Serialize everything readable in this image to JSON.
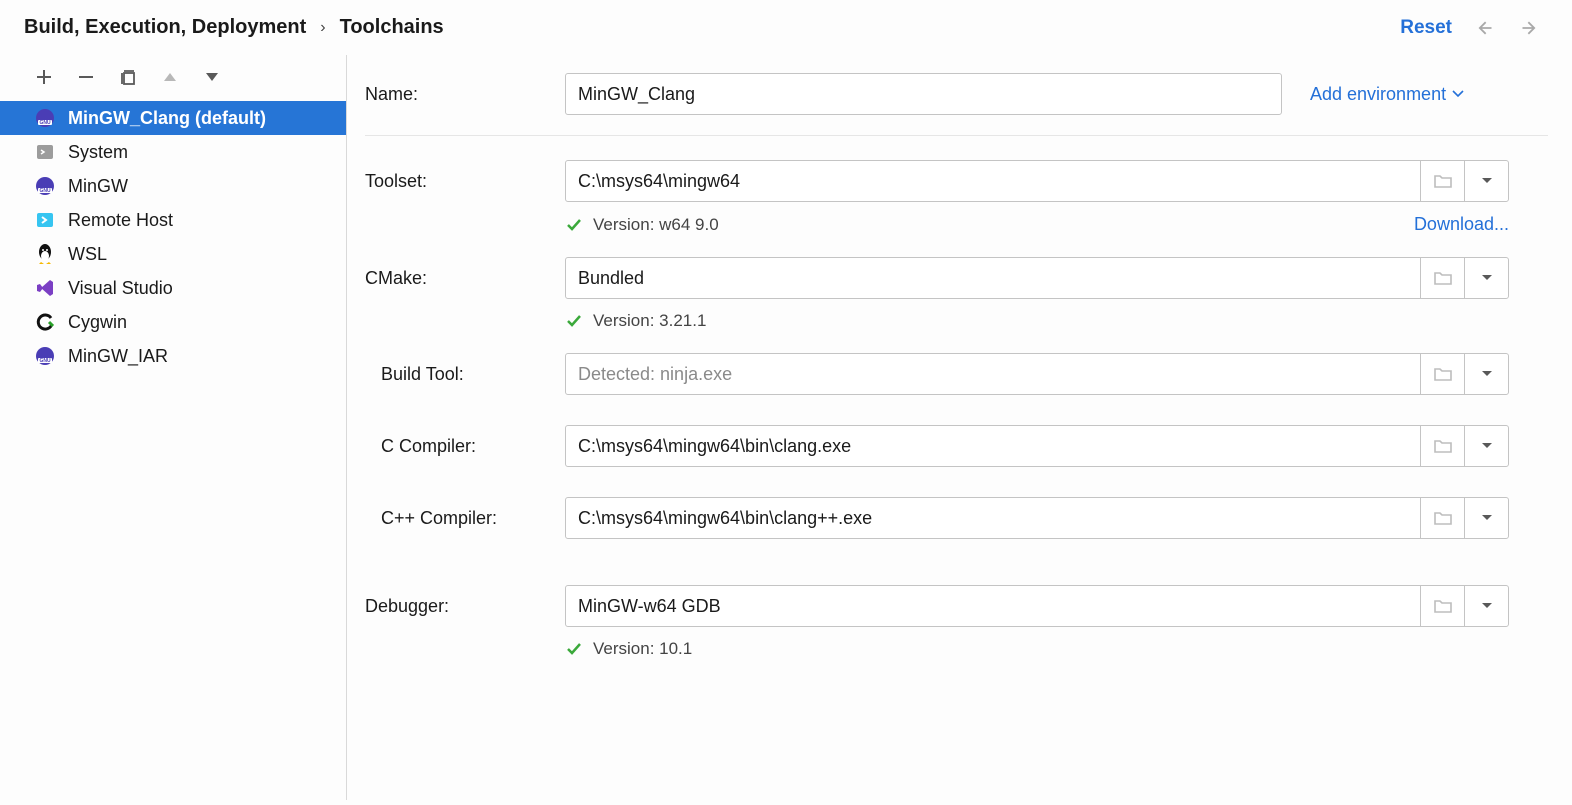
{
  "breadcrumb": {
    "parent": "Build, Execution, Deployment",
    "current": "Toolchains"
  },
  "actions": {
    "reset": "Reset"
  },
  "sidebar": {
    "items": [
      {
        "label": "MinGW_Clang (default)",
        "icon": "gnu",
        "selected": true
      },
      {
        "label": "System",
        "icon": "system",
        "selected": false
      },
      {
        "label": "MinGW",
        "icon": "gnu",
        "selected": false
      },
      {
        "label": "Remote Host",
        "icon": "remote",
        "selected": false
      },
      {
        "label": "WSL",
        "icon": "tux",
        "selected": false
      },
      {
        "label": "Visual Studio",
        "icon": "vs",
        "selected": false
      },
      {
        "label": "Cygwin",
        "icon": "cygwin",
        "selected": false
      },
      {
        "label": "MinGW_IAR",
        "icon": "gnu",
        "selected": false
      }
    ]
  },
  "form": {
    "name_label": "Name:",
    "name_value": "MinGW_Clang",
    "add_env": "Add environment",
    "toolset_label": "Toolset:",
    "toolset_value": "C:\\msys64\\mingw64",
    "toolset_version": "Version: w64 9.0",
    "download": "Download...",
    "cmake_label": "CMake:",
    "cmake_value": "Bundled",
    "cmake_version": "Version: 3.21.1",
    "buildtool_label": "Build Tool:",
    "buildtool_placeholder": "Detected: ninja.exe",
    "ccompiler_label": "C Compiler:",
    "ccompiler_value": "C:\\msys64\\mingw64\\bin\\clang.exe",
    "cppcompiler_label": "C++ Compiler:",
    "cppcompiler_value": "C:\\msys64\\mingw64\\bin\\clang++.exe",
    "debugger_label": "Debugger:",
    "debugger_value": "MinGW-w64 GDB",
    "debugger_version": "Version: 10.1"
  }
}
